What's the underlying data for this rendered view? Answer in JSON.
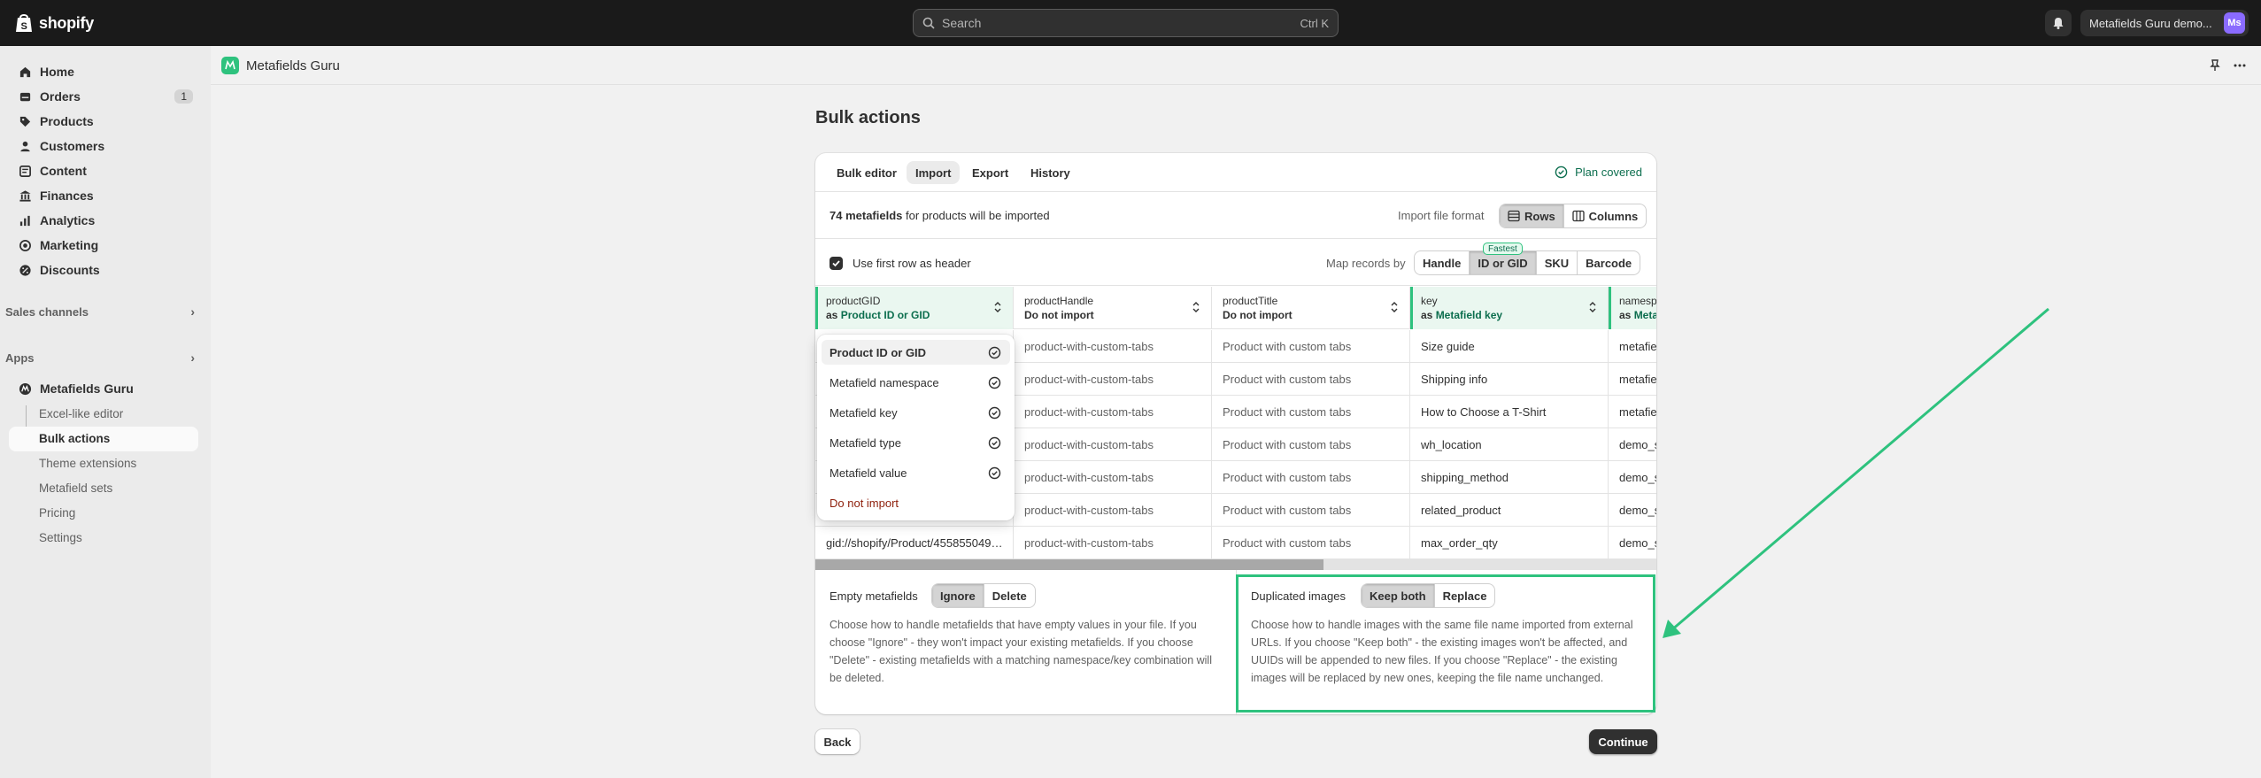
{
  "topbar": {
    "brand": "shopify",
    "search_placeholder": "Search",
    "search_shortcut": "Ctrl K",
    "store_name": "Metafields Guru demo...",
    "avatar_initials": "Ms"
  },
  "sidebar": {
    "items": [
      {
        "label": "Home",
        "icon": "home-icon"
      },
      {
        "label": "Orders",
        "icon": "orders-icon",
        "badge": "1"
      },
      {
        "label": "Products",
        "icon": "tag-icon"
      },
      {
        "label": "Customers",
        "icon": "person-icon"
      },
      {
        "label": "Content",
        "icon": "content-icon"
      },
      {
        "label": "Finances",
        "icon": "bank-icon"
      },
      {
        "label": "Analytics",
        "icon": "chart-icon"
      },
      {
        "label": "Marketing",
        "icon": "target-icon"
      },
      {
        "label": "Discounts",
        "icon": "discount-icon"
      }
    ],
    "sales_channels": "Sales channels",
    "apps": "Apps",
    "app_name": "Metafields Guru",
    "app_sub": [
      "Excel-like editor",
      "Bulk actions",
      "Theme extensions",
      "Metafield sets",
      "Pricing",
      "Settings"
    ]
  },
  "app_header": {
    "name": "Metafields Guru"
  },
  "page": {
    "title": "Bulk actions",
    "tabs": [
      "Bulk editor",
      "Import",
      "Export",
      "History"
    ],
    "plan": "Plan covered",
    "count_bold": "74 metafields",
    "count_rest": " for products will be imported",
    "format_label": "Import file format",
    "format_options": [
      "Rows",
      "Columns"
    ],
    "header_checkbox": "Use first row as header",
    "map_label": "Map records by",
    "map_options": [
      "Handle",
      "ID or GID",
      "SKU",
      "Barcode"
    ],
    "fastest": "Fastest"
  },
  "table": {
    "columns": [
      {
        "name": "productGID",
        "prefix": "as ",
        "mapping": "Product ID or GID"
      },
      {
        "name": "productHandle",
        "prefix": "",
        "mapping": "Do not import"
      },
      {
        "name": "productTitle",
        "prefix": "",
        "mapping": "Do not import"
      },
      {
        "name": "key",
        "prefix": "as ",
        "mapping": "Metafield key"
      },
      {
        "name": "namespa",
        "prefix": "as ",
        "mapping": "Meta"
      }
    ],
    "rows": [
      [
        "",
        "product-with-custom-tabs",
        "Product with custom tabs",
        "Size guide",
        "metafiel"
      ],
      [
        "",
        "product-with-custom-tabs",
        "Product with custom tabs",
        "Shipping info",
        "metafiel"
      ],
      [
        "",
        "product-with-custom-tabs",
        "Product with custom tabs",
        "How to Choose a T-Shirt",
        "metafiel"
      ],
      [
        "",
        "product-with-custom-tabs",
        "Product with custom tabs",
        "wh_location",
        "demo_s"
      ],
      [
        "",
        "product-with-custom-tabs",
        "Product with custom tabs",
        "shipping_method",
        "demo_s"
      ],
      [
        "",
        "product-with-custom-tabs",
        "Product with custom tabs",
        "related_product",
        "demo_s"
      ],
      [
        "gid://shopify/Product/455855049…",
        "product-with-custom-tabs",
        "Product with custom tabs",
        "max_order_qty",
        "demo_s"
      ]
    ]
  },
  "dropdown": {
    "items": [
      "Product ID or GID",
      "Metafield namespace",
      "Metafield key",
      "Metafield type",
      "Metafield value",
      "Do not import"
    ]
  },
  "options": {
    "empty": {
      "title": "Empty metafields",
      "buttons": [
        "Ignore",
        "Delete"
      ],
      "desc": "Choose how to handle metafields that have empty values in your file. If you choose \"Ignore\" - they won't impact your existing metafields. If you choose \"Delete\" - existing metafields with a matching namespace/key combination will be deleted."
    },
    "images": {
      "title": "Duplicated images",
      "buttons": [
        "Keep both",
        "Replace"
      ],
      "desc": "Choose how to handle images with the same file name imported from external URLs. If you choose \"Keep both\" - the existing images won't be affected, and UUIDs will be appended to new files. If you choose \"Replace\" - the existing images will be replaced by new ones, keeping the file name unchanged."
    }
  },
  "footer": {
    "back": "Back",
    "continue": "Continue"
  },
  "colors": {
    "accent_green": "#2ec27e",
    "topbar": "#1a1a1a"
  }
}
